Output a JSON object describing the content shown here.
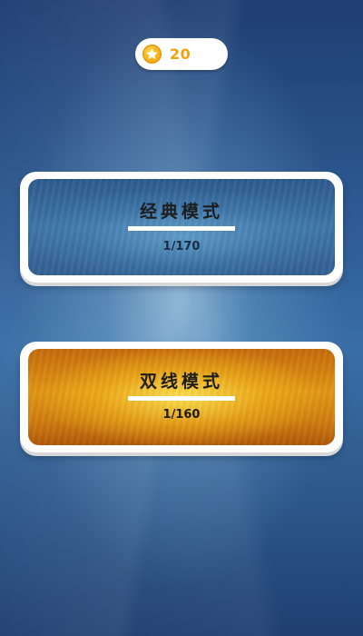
{
  "header": {
    "coins": "20",
    "coin_icon": "star-coin-icon"
  },
  "modes": [
    {
      "title": "经典模式",
      "progress": "1/170"
    },
    {
      "title": "双线模式",
      "progress": "1/160"
    }
  ],
  "colors": {
    "background": "#2e5b94",
    "coin_accent": "#f2a20c",
    "classic_card": "#3f76a8",
    "double_card": "#e29613"
  }
}
